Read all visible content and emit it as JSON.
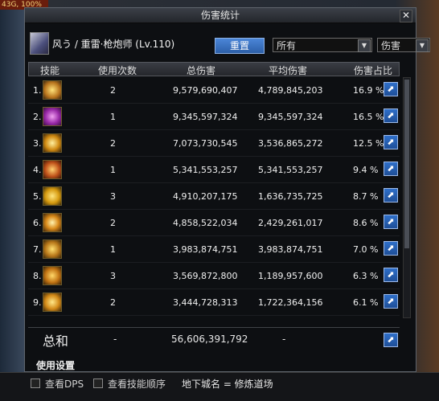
{
  "hud": {
    "top_left": "43G, 100%"
  },
  "window": {
    "title": "伤害统计"
  },
  "character": {
    "name": "风う / 重雷·枪炮师 (Lv.110)"
  },
  "controls": {
    "reset_label": "重置",
    "target_value": "所有",
    "metric_value": "伤害"
  },
  "table": {
    "headers": [
      "技能",
      "使用次数",
      "总伤害",
      "平均伤害",
      "伤害占比"
    ],
    "rows": [
      {
        "rank": "1.",
        "uses": "2",
        "total": "9,579,690,407",
        "avg": "4,789,845,203",
        "pct": "16.9 %"
      },
      {
        "rank": "2.",
        "uses": "1",
        "total": "9,345,597,324",
        "avg": "9,345,597,324",
        "pct": "16.5 %"
      },
      {
        "rank": "3.",
        "uses": "2",
        "total": "7,073,730,545",
        "avg": "3,536,865,272",
        "pct": "12.5 %"
      },
      {
        "rank": "4.",
        "uses": "1",
        "total": "5,341,553,257",
        "avg": "5,341,553,257",
        "pct": "9.4 %"
      },
      {
        "rank": "5.",
        "uses": "3",
        "total": "4,910,207,175",
        "avg": "1,636,735,725",
        "pct": "8.7 %"
      },
      {
        "rank": "6.",
        "uses": "2",
        "total": "4,858,522,034",
        "avg": "2,429,261,017",
        "pct": "8.6 %"
      },
      {
        "rank": "7.",
        "uses": "1",
        "total": "3,983,874,751",
        "avg": "3,983,874,751",
        "pct": "7.0 %"
      },
      {
        "rank": "8.",
        "uses": "3",
        "total": "3,569,872,800",
        "avg": "1,189,957,600",
        "pct": "6.3 %"
      },
      {
        "rank": "9.",
        "uses": "2",
        "total": "3,444,728,313",
        "avg": "1,722,364,156",
        "pct": "6.1 %"
      }
    ],
    "total": {
      "label": "总和",
      "uses": "-",
      "total": "56,606,391,792",
      "avg": "-"
    }
  },
  "usage_settings": "使用设置",
  "bottom": {
    "dps_label": "查看DPS",
    "order_label": "查看技能顺序",
    "dungeon": "地下城名 = 修炼道场"
  },
  "colors": {
    "accent_blue": "#2f6fc9",
    "window_bg": "#0d0f12"
  }
}
